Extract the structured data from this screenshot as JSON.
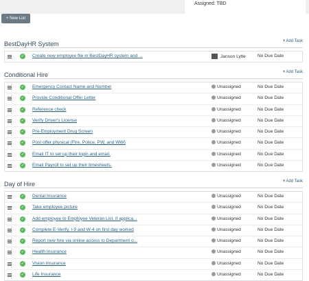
{
  "header": {
    "assigned": "Assigned: TBD"
  },
  "toolbar": {
    "new_list_label": "+ New List"
  },
  "sections": [
    {
      "title": "BestDayHR System",
      "add_task": "Add Task",
      "tasks": [
        {
          "name": "Create new employee file in BestDayHR system and ...",
          "assignee": "Janson Lytle",
          "due": "No Due Date"
        }
      ]
    },
    {
      "title": "Conditional Hire",
      "add_task": "Add Task",
      "tasks": [
        {
          "name": "Emergency Contact Name and Number",
          "assignee": "Unassigned",
          "due": "No Due Date"
        },
        {
          "name": "Provide Conditional Offer Letter",
          "assignee": "Unassigned",
          "due": "No Due Date"
        },
        {
          "name": "Reference check",
          "assignee": "Unassigned",
          "due": "No Due Date"
        },
        {
          "name": "Verify Driver's License",
          "assignee": "Unassigned",
          "due": "No Due Date"
        },
        {
          "name": "Pre-Employment Drug Screen",
          "assignee": "Unassigned",
          "due": "No Due Date"
        },
        {
          "name": "Post offer physical (Fire, Police, PW, and WW)",
          "assignee": "Unassigned",
          "due": "No Due Date"
        },
        {
          "name": "Email IT to set up their login and email.",
          "assignee": "Unassigned",
          "due": "No Due Date"
        },
        {
          "name": "Email Payroll to set up their timesheets.",
          "assignee": "Unassigned",
          "due": "No Due Date"
        }
      ]
    },
    {
      "title": "Day of Hire",
      "add_task": "Add Task",
      "tasks": [
        {
          "name": "Dental Insurance",
          "assignee": "Unassigned",
          "due": "No Due Date"
        },
        {
          "name": "Take employee picture",
          "assignee": "Unassigned",
          "due": "No Due Date"
        },
        {
          "name": "Add employee to Employee Veteran List, if applica...",
          "assignee": "Unassigned",
          "due": "No Due Date"
        },
        {
          "name": "Complete E-Verify, I-9 and W-4 on first day worked",
          "assignee": "Unassigned",
          "due": "No Due Date"
        },
        {
          "name": "Report new hire via online access to Department o...",
          "assignee": "Unassigned",
          "due": "No Due Date"
        },
        {
          "name": "Health Insurance",
          "assignee": "Unassigned",
          "due": "No Due Date"
        },
        {
          "name": "Vision Insurance",
          "assignee": "Unassigned",
          "due": "No Due Date"
        },
        {
          "name": "Life Insurance",
          "assignee": "Unassigned",
          "due": "No Due Date"
        }
      ]
    }
  ],
  "colors": {
    "check": "#5cb85c",
    "link": "#2b6289",
    "button": "#6c7a86"
  },
  "icons": {
    "drag": "drag-handle-icon",
    "check": "check-circle-icon",
    "user": "user-icon"
  }
}
